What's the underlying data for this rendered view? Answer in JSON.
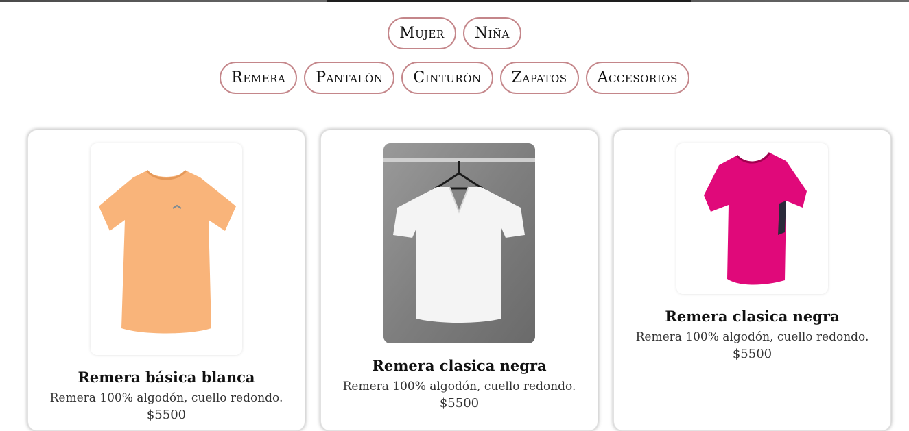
{
  "filters": {
    "gender": [
      {
        "label": "Mujer"
      },
      {
        "label": "Niña"
      }
    ],
    "category": [
      {
        "label": "Remera"
      },
      {
        "label": "Pantalón"
      },
      {
        "label": "Cinturón"
      },
      {
        "label": "Zapatos"
      },
      {
        "label": "Accesorios"
      }
    ]
  },
  "products": [
    {
      "title": "Remera básica blanca",
      "description": "Remera 100% algodón, cuello redondo.",
      "price": "$5500",
      "image_icon": "peach-tshirt-icon",
      "shirt_color": "#f9b47a"
    },
    {
      "title": "Remera clasica negra",
      "description": "Remera 100% algodón, cuello redondo.",
      "price": "$5500",
      "image_icon": "white-vneck-tshirt-icon",
      "shirt_color": "#f4f4f4"
    },
    {
      "title": "Remera clasica negra",
      "description": "Remera 100% algodón, cuello redondo.",
      "price": "$5500",
      "image_icon": "magenta-tshirt-icon",
      "shirt_color": "#e0097a"
    }
  ],
  "colors": {
    "pill_border": "#c4868a",
    "text": "#111111"
  }
}
